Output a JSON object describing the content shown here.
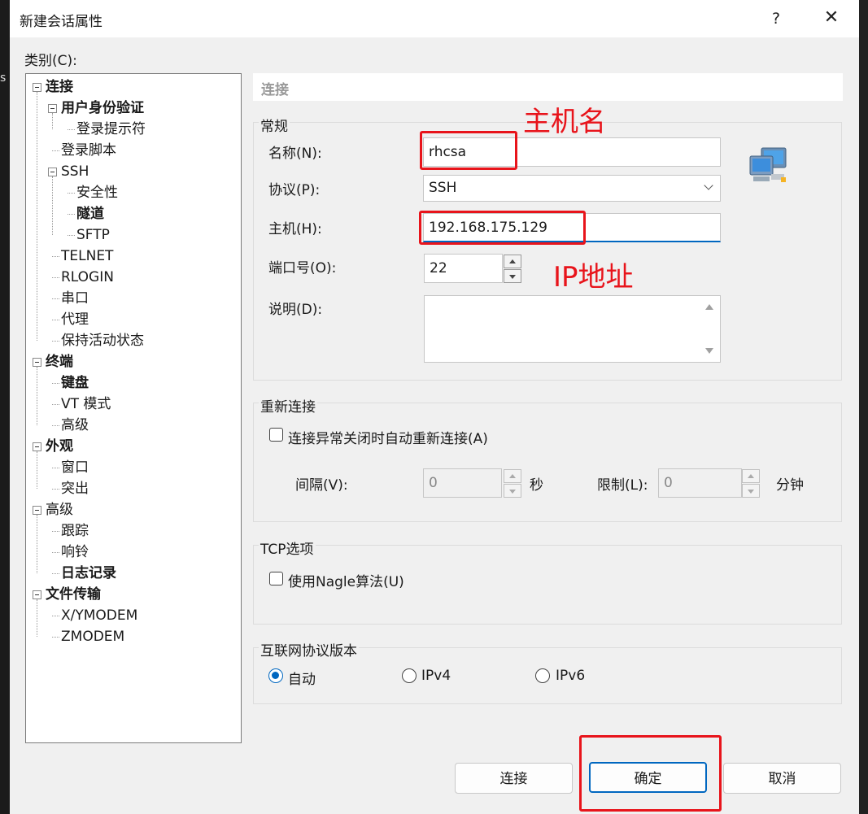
{
  "window": {
    "title": "新建会话属性",
    "help": "?",
    "close": "✕"
  },
  "category_label": "类别(C):",
  "tree": [
    {
      "label": "连接",
      "level": 0,
      "bold": true
    },
    {
      "label": "用户身份验证",
      "level": 1,
      "bold": true
    },
    {
      "label": "登录提示符",
      "level": 2,
      "bold": false
    },
    {
      "label": "登录脚本",
      "level": 1,
      "bold": false
    },
    {
      "label": "SSH",
      "level": 1,
      "bold": false
    },
    {
      "label": "安全性",
      "level": 2,
      "bold": false
    },
    {
      "label": "隧道",
      "level": 2,
      "bold": true
    },
    {
      "label": "SFTP",
      "level": 2,
      "bold": false
    },
    {
      "label": "TELNET",
      "level": 1,
      "bold": false
    },
    {
      "label": "RLOGIN",
      "level": 1,
      "bold": false
    },
    {
      "label": "串口",
      "level": 1,
      "bold": false
    },
    {
      "label": "代理",
      "level": 1,
      "bold": false
    },
    {
      "label": "保持活动状态",
      "level": 1,
      "bold": false
    },
    {
      "label": "终端",
      "level": 0,
      "bold": true
    },
    {
      "label": "键盘",
      "level": 1,
      "bold": true
    },
    {
      "label": "VT 模式",
      "level": 1,
      "bold": false
    },
    {
      "label": "高级",
      "level": 1,
      "bold": false
    },
    {
      "label": "外观",
      "level": 0,
      "bold": true
    },
    {
      "label": "窗口",
      "level": 1,
      "bold": false
    },
    {
      "label": "突出",
      "level": 1,
      "bold": false
    },
    {
      "label": "高级",
      "level": 0,
      "bold": false
    },
    {
      "label": "跟踪",
      "level": 1,
      "bold": false
    },
    {
      "label": "响铃",
      "level": 1,
      "bold": false
    },
    {
      "label": "日志记录",
      "level": 1,
      "bold": true
    },
    {
      "label": "文件传输",
      "level": 0,
      "bold": true
    },
    {
      "label": "X/YMODEM",
      "level": 1,
      "bold": false
    },
    {
      "label": "ZMODEM",
      "level": 1,
      "bold": false
    }
  ],
  "section_title": "连接",
  "general": {
    "group_label": "常规",
    "name_label": "名称(N):",
    "name_value": "rhcsa",
    "protocol_label": "协议(P):",
    "protocol_value": "SSH",
    "host_label": "主机(H):",
    "host_value": "192.168.175.129",
    "port_label": "端口号(O):",
    "port_value": "22",
    "desc_label": "说明(D):",
    "desc_value": ""
  },
  "reconnect": {
    "group_label": "重新连接",
    "checkbox_label": "连接异常关闭时自动重新连接(A)",
    "checked": false,
    "interval_label": "间隔(V):",
    "interval_value": "0",
    "interval_unit": "秒",
    "limit_label": "限制(L):",
    "limit_value": "0",
    "limit_unit": "分钟"
  },
  "tcp": {
    "group_label": "TCP选项",
    "nagle_label": "使用Nagle算法(U)",
    "checked": false
  },
  "ip_version": {
    "group_label": "互联网协议版本",
    "options": [
      "自动",
      "IPv4",
      "IPv6"
    ],
    "selected": "自动"
  },
  "buttons": {
    "connect": "连接",
    "ok": "确定",
    "cancel": "取消"
  },
  "annotations": {
    "hostname_note": "主机名",
    "ip_note": "IP地址",
    "color": "#e8141b"
  },
  "background": {
    "left_char": "s"
  }
}
